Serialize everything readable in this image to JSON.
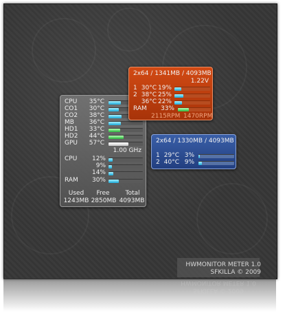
{
  "main_panel": {
    "temps": [
      {
        "label": "CPU",
        "value": "35°C",
        "level": 0.35,
        "color": "cyan"
      },
      {
        "label": "CO1",
        "value": "30°C",
        "level": 0.3,
        "color": "cyan"
      },
      {
        "label": "CO2",
        "value": "38°C",
        "level": 0.38,
        "color": "cyan"
      },
      {
        "label": "MB",
        "value": "36°C",
        "level": 0.36,
        "color": "cyan"
      },
      {
        "label": "HD1",
        "value": "33°C",
        "level": 0.33,
        "color": "green"
      },
      {
        "label": "HD2",
        "value": "44°C",
        "level": 0.44,
        "color": "green"
      },
      {
        "label": "GPU",
        "value": "57°C",
        "level": 0.57,
        "color": "white"
      }
    ],
    "gpu_clock": "1.00 GHz",
    "cpu_label": "CPU",
    "cpu_cores": [
      {
        "value": "12%",
        "level": 0.12
      },
      {
        "value": "9%",
        "level": 0.09
      },
      {
        "value": "14%",
        "level": 0.14
      }
    ],
    "ram_label": "RAM",
    "ram_value": "30%",
    "ram_level": 0.3,
    "mem_headers": [
      "Used",
      "Free",
      "Total"
    ],
    "mem_values": [
      "1243MB",
      "2850MB",
      "4093MB"
    ]
  },
  "orange_panel": {
    "title": "2x64 / 1341MB / 4093MB",
    "voltage": "1.22V",
    "cores": [
      {
        "num": "1",
        "temp": "30°C",
        "load": "19%",
        "level": 0.19
      },
      {
        "num": "2",
        "temp": "38°C",
        "load": "25%",
        "level": 0.25
      },
      {
        "num": "",
        "temp": "36°C",
        "load": "22%",
        "level": 0.22
      }
    ],
    "ram_label": "RAM",
    "ram_value": "33%",
    "ram_level": 0.33,
    "fan1": "2115RPM",
    "fan2": "1470RPM"
  },
  "blue_panel": {
    "title": "2x64 / 1330MB / 4093MB",
    "cores": [
      {
        "num": "1",
        "temp": "29°C",
        "load": "3%",
        "level": 0.03
      },
      {
        "num": "2",
        "temp": "40°C",
        "load": "9%",
        "level": 0.09
      }
    ]
  },
  "caption": {
    "line1": "HWMONITOR METER 1.0",
    "line2": "SFKILLA © 2009"
  }
}
